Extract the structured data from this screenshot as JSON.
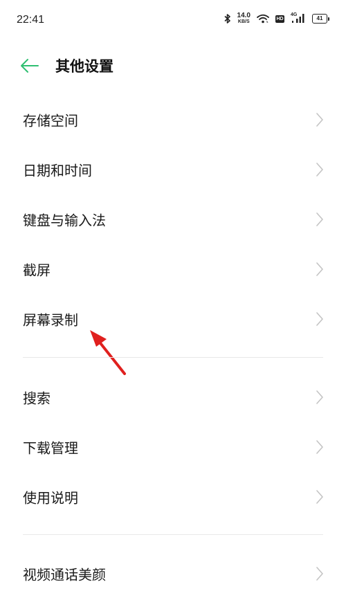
{
  "status_bar": {
    "time": "22:41",
    "net_speed_value": "14.0",
    "net_speed_unit": "KB/S",
    "hd_label": "HD",
    "signal_label": "4G",
    "battery_level": "41",
    "icons": [
      "bluetooth-icon",
      "wifi-icon",
      "hd-icon",
      "signal-icon",
      "battery-icon"
    ]
  },
  "header": {
    "back_icon": "arrow-left-icon",
    "title": "其他设置"
  },
  "colors": {
    "accent": "#2fbf71",
    "text": "#1a1a1a",
    "chevron": "#c4c4c4",
    "divider": "#e8e8e8",
    "annotation": "#e0201e"
  },
  "groups": [
    {
      "items": [
        "存储空间",
        "日期和时间",
        "键盘与输入法",
        "截屏",
        "屏幕录制"
      ]
    },
    {
      "items": [
        "搜索",
        "下载管理",
        "使用说明"
      ]
    },
    {
      "items": [
        "视频通话美颜"
      ]
    }
  ]
}
